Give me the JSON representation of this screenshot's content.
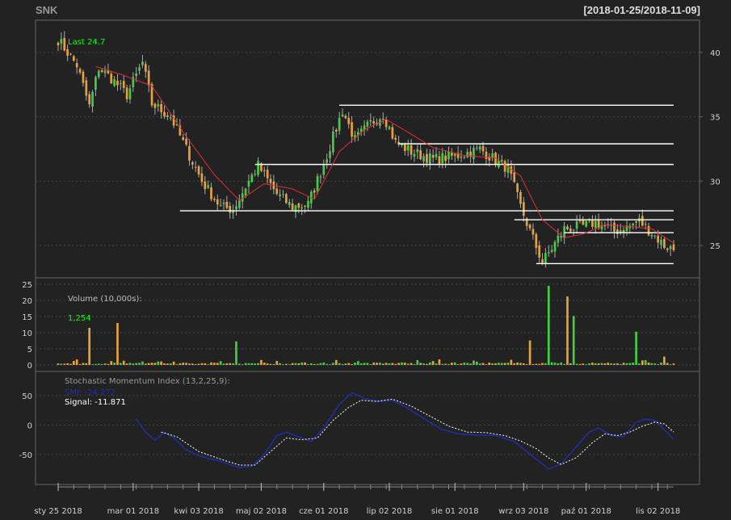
{
  "window": {
    "symbol": "SNK",
    "date_range": "[2018-01-25/2018-11-09]"
  },
  "colors": {
    "background": "#222222",
    "panel_border": "#666666",
    "grid": "#444444",
    "up": "#44cc44",
    "down": "#e8a13a",
    "sma": "#e03030",
    "smi": "#1f2fb0",
    "signal": "#ffffff",
    "last_label": "#00ff00",
    "hline": "#ffffff",
    "title": "#999999",
    "range_text": "#dddddd"
  },
  "chart_data": [
    {
      "type": "candlestick",
      "panel": "price",
      "last_label": "Last 24.7",
      "ylim": [
        23.0,
        42.0
      ],
      "yticks": [
        25,
        30,
        35,
        40
      ],
      "x_dates": [
        "2018-01-25",
        "2018-11-09"
      ],
      "sessions": 198,
      "xticks": [
        {
          "index": 0,
          "label": "sty 25 2018"
        },
        {
          "index": 24,
          "label": "mar 01 2018"
        },
        {
          "index": 45,
          "label": "kwi 03 2018"
        },
        {
          "index": 65,
          "label": "maj 02 2018"
        },
        {
          "index": 85,
          "label": "cze 01 2018"
        },
        {
          "index": 106,
          "label": "lip 02 2018"
        },
        {
          "index": 127,
          "label": "sie 01 2018"
        },
        {
          "index": 149,
          "label": "wrz 03 2018"
        },
        {
          "index": 169,
          "label": "paź 01 2018"
        },
        {
          "index": 192,
          "label": "lis 02 2018"
        }
      ],
      "price_anchors": [
        [
          0,
          41.0
        ],
        [
          6,
          39.0
        ],
        [
          10,
          35.8
        ],
        [
          13,
          38.8
        ],
        [
          17,
          38.0
        ],
        [
          22,
          36.7
        ],
        [
          27,
          39.2
        ],
        [
          30,
          36.0
        ],
        [
          36,
          35.0
        ],
        [
          40,
          33.0
        ],
        [
          46,
          30.0
        ],
        [
          52,
          28.0
        ],
        [
          56,
          27.8
        ],
        [
          61,
          30.0
        ],
        [
          64,
          31.2
        ],
        [
          70,
          29.0
        ],
        [
          75,
          28.0
        ],
        [
          80,
          28.2
        ],
        [
          86,
          32.0
        ],
        [
          91,
          35.5
        ],
        [
          95,
          33.2
        ],
        [
          100,
          34.5
        ],
        [
          104,
          35.2
        ],
        [
          108,
          33.0
        ],
        [
          113,
          32.3
        ],
        [
          120,
          31.7
        ],
        [
          128,
          32.0
        ],
        [
          135,
          32.5
        ],
        [
          140,
          31.6
        ],
        [
          144,
          31.0
        ],
        [
          148,
          28.0
        ],
        [
          152,
          25.5
        ],
        [
          155,
          23.7
        ],
        [
          158,
          24.8
        ],
        [
          162,
          26.3
        ],
        [
          168,
          26.5
        ],
        [
          172,
          26.8
        ],
        [
          178,
          26.1
        ],
        [
          182,
          26.4
        ],
        [
          186,
          26.9
        ],
        [
          190,
          26.0
        ],
        [
          194,
          25.0
        ],
        [
          197,
          24.7
        ]
      ],
      "sma_anchors": [
        [
          12,
          38.9
        ],
        [
          20,
          38.3
        ],
        [
          30,
          37.4
        ],
        [
          40,
          33.8
        ],
        [
          50,
          30.5
        ],
        [
          58,
          28.5
        ],
        [
          66,
          29.8
        ],
        [
          75,
          29.4
        ],
        [
          82,
          28.6
        ],
        [
          90,
          32.3
        ],
        [
          98,
          34.0
        ],
        [
          105,
          34.8
        ],
        [
          112,
          33.8
        ],
        [
          120,
          32.6
        ],
        [
          130,
          32.0
        ],
        [
          140,
          31.8
        ],
        [
          148,
          30.4
        ],
        [
          155,
          27.0
        ],
        [
          162,
          25.6
        ],
        [
          168,
          25.9
        ],
        [
          175,
          26.6
        ],
        [
          182,
          26.5
        ],
        [
          190,
          26.3
        ],
        [
          197,
          25.2
        ]
      ],
      "horizontal_levels": [
        {
          "y": 35.9,
          "from": 90,
          "to": 197
        },
        {
          "y": 32.9,
          "from": 109,
          "to": 197
        },
        {
          "y": 31.3,
          "from": 63,
          "to": 197
        },
        {
          "y": 27.7,
          "from": 39,
          "to": 197
        },
        {
          "y": 27.0,
          "from": 146,
          "to": 197
        },
        {
          "y": 26.0,
          "from": 162,
          "to": 197
        },
        {
          "y": 23.6,
          "from": 153,
          "to": 197
        }
      ]
    },
    {
      "type": "bar",
      "panel": "volume",
      "label": "Volume (10,000s):",
      "last_value": "1,254",
      "ylim": [
        0,
        25
      ],
      "yticks": [
        0,
        5,
        10,
        15,
        20,
        25
      ],
      "spikes": [
        {
          "index": 10,
          "value": 11.5,
          "dir": "down"
        },
        {
          "index": 19,
          "value": 13.0,
          "dir": "down"
        },
        {
          "index": 57,
          "value": 7.3,
          "dir": "up"
        },
        {
          "index": 151,
          "value": 7.6,
          "dir": "down"
        },
        {
          "index": 157,
          "value": 24.5,
          "dir": "up"
        },
        {
          "index": 163,
          "value": 21.2,
          "dir": "down"
        },
        {
          "index": 165,
          "value": 15.2,
          "dir": "up"
        },
        {
          "index": 185,
          "value": 10.3,
          "dir": "up"
        },
        {
          "index": 194,
          "value": 2.6,
          "dir": "down"
        }
      ]
    },
    {
      "type": "line",
      "panel": "smi",
      "label": "Stochastic Momentum Index (13,2,25,9):",
      "smi_label": "SMI: -24.272",
      "signal_label": "Signal: -11.871",
      "ylim": [
        -90,
        80
      ],
      "yticks": [
        -50,
        0,
        50
      ],
      "smi_anchors": [
        [
          25,
          10
        ],
        [
          28,
          -12
        ],
        [
          31,
          -26
        ],
        [
          34,
          -12
        ],
        [
          37,
          -22
        ],
        [
          41,
          -42
        ],
        [
          45,
          -52
        ],
        [
          52,
          -62
        ],
        [
          58,
          -72
        ],
        [
          62,
          -70
        ],
        [
          66,
          -50
        ],
        [
          70,
          -18
        ],
        [
          73,
          -12
        ],
        [
          77,
          -20
        ],
        [
          81,
          -28
        ],
        [
          85,
          -5
        ],
        [
          90,
          35
        ],
        [
          94,
          55
        ],
        [
          98,
          45
        ],
        [
          103,
          40
        ],
        [
          107,
          42
        ],
        [
          112,
          28
        ],
        [
          118,
          8
        ],
        [
          123,
          -8
        ],
        [
          128,
          -15
        ],
        [
          134,
          -17
        ],
        [
          140,
          -18
        ],
        [
          146,
          -28
        ],
        [
          150,
          -45
        ],
        [
          154,
          -62
        ],
        [
          157,
          -75
        ],
        [
          161,
          -66
        ],
        [
          165,
          -42
        ],
        [
          170,
          -12
        ],
        [
          173,
          -5
        ],
        [
          177,
          -18
        ],
        [
          181,
          -20
        ],
        [
          185,
          5
        ],
        [
          188,
          10
        ],
        [
          191,
          8
        ],
        [
          194,
          -8
        ],
        [
          197,
          -24.3
        ]
      ],
      "signal_anchors": [
        [
          33,
          -12
        ],
        [
          38,
          -20
        ],
        [
          45,
          -45
        ],
        [
          52,
          -58
        ],
        [
          58,
          -68
        ],
        [
          63,
          -68
        ],
        [
          68,
          -45
        ],
        [
          73,
          -22
        ],
        [
          78,
          -25
        ],
        [
          83,
          -22
        ],
        [
          88,
          8
        ],
        [
          93,
          30
        ],
        [
          97,
          42
        ],
        [
          102,
          40
        ],
        [
          107,
          44
        ],
        [
          113,
          32
        ],
        [
          119,
          15
        ],
        [
          125,
          -2
        ],
        [
          131,
          -12
        ],
        [
          137,
          -13
        ],
        [
          143,
          -18
        ],
        [
          148,
          -27
        ],
        [
          153,
          -40
        ],
        [
          157,
          -56
        ],
        [
          161,
          -67
        ],
        [
          166,
          -55
        ],
        [
          171,
          -30
        ],
        [
          175,
          -15
        ],
        [
          179,
          -18
        ],
        [
          183,
          -12
        ],
        [
          187,
          -2
        ],
        [
          191,
          5
        ],
        [
          194,
          2
        ],
        [
          197,
          -11.9
        ]
      ]
    }
  ]
}
